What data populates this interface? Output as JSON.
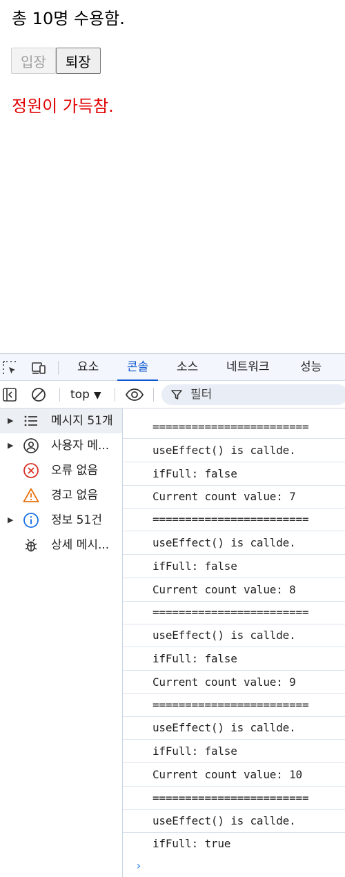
{
  "page": {
    "heading": "총 10명 수용함.",
    "enter_button": "입장",
    "exit_button": "퇴장",
    "full_message": "정원이 가득참."
  },
  "devtools": {
    "tabs": [
      "요소",
      "콘솔",
      "소스",
      "네트워크",
      "성능"
    ],
    "active_tab": "콘솔",
    "context": "top",
    "filter_placeholder": "필터",
    "sidebar": [
      {
        "label": "메시지 51개",
        "icon": "list-icon",
        "expandable": true
      },
      {
        "label": "사용자 메...",
        "icon": "user-icon",
        "expandable": true
      },
      {
        "label": "오류 없음",
        "icon": "error-icon",
        "expandable": false
      },
      {
        "label": "경고 없음",
        "icon": "warning-icon",
        "expandable": false
      },
      {
        "label": "정보 51건",
        "icon": "info-icon",
        "expandable": true
      },
      {
        "label": "상세 메시...",
        "icon": "bug-icon",
        "expandable": false
      }
    ],
    "logs": [
      "========================",
      "useEffect() is callde.",
      "ifFull: false",
      "Current count value: 7",
      "========================",
      "useEffect() is callde.",
      "ifFull: false",
      "Current count value: 8",
      "========================",
      "useEffect() is callde.",
      "ifFull: false",
      "Current count value: 9",
      "========================",
      "useEffect() is callde.",
      "ifFull: false",
      "Current count value: 10",
      "========================",
      "useEffect() is callde.",
      "ifFull: true"
    ],
    "prompt_symbol": "›"
  },
  "colors": {
    "warning_text": "#e00000",
    "accent": "#0b57d0",
    "error_icon": "#d93025",
    "warning_icon": "#e8710a",
    "info_icon": "#1a73e8"
  }
}
